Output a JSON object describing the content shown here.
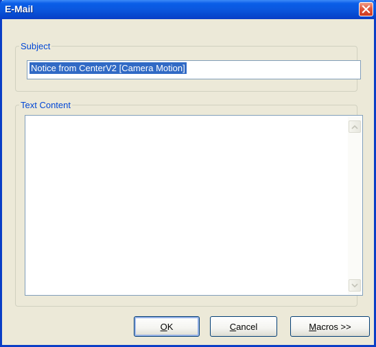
{
  "window": {
    "title": "E-Mail"
  },
  "subject": {
    "legend": "Subject",
    "value": "Notice from CenterV2 [Camera Motion]"
  },
  "content": {
    "legend": "Text Content",
    "value": ""
  },
  "buttons": {
    "ok": {
      "mnemonic": "O",
      "rest": "K"
    },
    "cancel": {
      "mnemonic": "C",
      "rest": "ancel"
    },
    "macros": {
      "mnemonic": "M",
      "rest": "acros >>"
    }
  },
  "colors": {
    "titlebar": "#0a5ee8",
    "selection": "#316ac5",
    "legend": "#0046d5",
    "close": "#e2583e"
  },
  "icons": {
    "close": "close-icon",
    "scroll_up": "scroll-up-icon",
    "scroll_down": "scroll-down-icon"
  }
}
